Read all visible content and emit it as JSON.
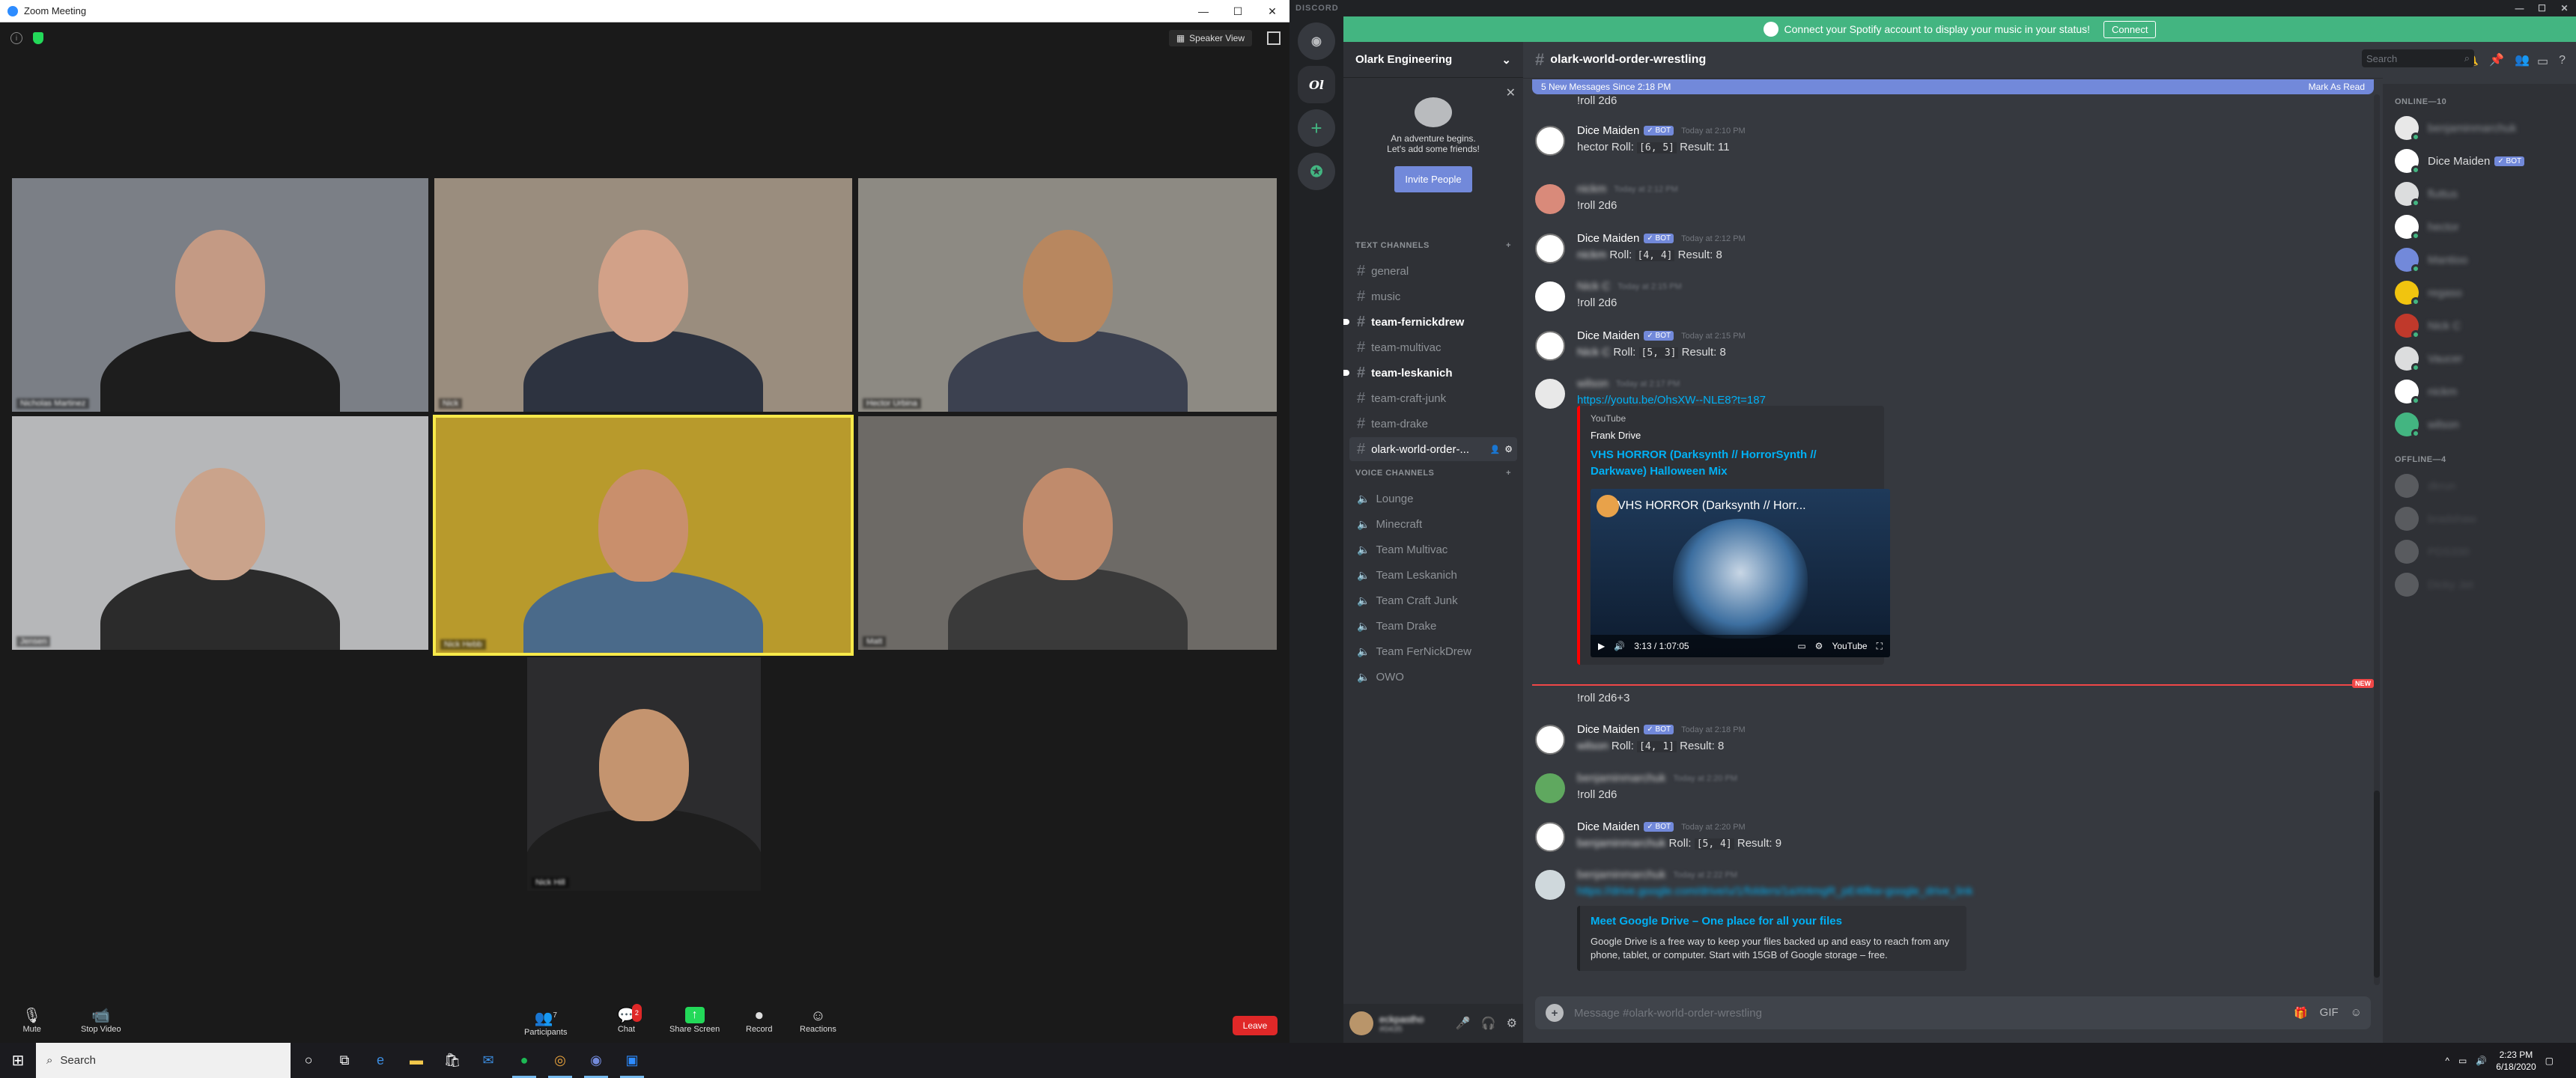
{
  "zoom": {
    "window_title": "Zoom Meeting",
    "speaker_view": "Speaker View",
    "toolbar": {
      "mute": "Mute",
      "stop_video": "Stop Video",
      "participants": "Participants",
      "participants_count": "7",
      "chat": "Chat",
      "chat_badge": "2",
      "share_screen": "Share Screen",
      "record": "Record",
      "reactions": "Reactions",
      "leave": "Leave"
    },
    "participants": [
      {
        "name": "Nicholas Martinez",
        "bg": "#7b7f86",
        "face": "#c49a84",
        "shirt": "#1d1d1d"
      },
      {
        "name": "Nick",
        "bg": "#9a8d7e",
        "face": "#d2a188",
        "shirt": "#2d3340"
      },
      {
        "name": "Hector Urbina",
        "bg": "#8d8a83",
        "face": "#b8875f",
        "shirt": "#3c4150"
      },
      {
        "name": "Jensen",
        "bg": "#b6b7b9",
        "face": "#caa38b",
        "shirt": "#2b2b2b"
      },
      {
        "name": "Nick Hebb",
        "bg": "#b89a2c",
        "face": "#c98f6c",
        "shirt": "#4a6a8a"
      },
      {
        "name": "Matt",
        "bg": "#6d6a66",
        "face": "#c08b6c",
        "shirt": "#3a3a3a"
      },
      {
        "name": "Nick Hill",
        "bg": "#2c2c2e",
        "face": "#c4946f",
        "shirt": "#1e1e1e"
      }
    ]
  },
  "discord": {
    "titlebar": "DISCORD",
    "spotify_text": "Connect your Spotify account to display your music in your status!",
    "spotify_connect": "Connect",
    "server_name": "Olark Engineering",
    "welcome_line1": "An adventure begins.",
    "welcome_line2": "Let's add some friends!",
    "invite_button": "Invite People",
    "text_channels_label": "TEXT CHANNELS",
    "voice_channels_label": "VOICE CHANNELS",
    "text_channels": [
      {
        "name": "general",
        "unread": false
      },
      {
        "name": "music",
        "unread": false
      },
      {
        "name": "team-fernickdrew",
        "unread": true
      },
      {
        "name": "team-multivac",
        "unread": false
      },
      {
        "name": "team-leskanich",
        "unread": true
      },
      {
        "name": "team-craft-junk",
        "unread": false
      },
      {
        "name": "team-drake",
        "unread": false
      },
      {
        "name": "olark-world-order-...",
        "unread": false,
        "selected": true
      }
    ],
    "voice_channels": [
      "Lounge",
      "Minecraft",
      "Team Multivac",
      "Team Leskanich",
      "Team Craft Junk",
      "Team Drake",
      "Team FerNickDrew",
      "OWO"
    ],
    "user_name": "eckpastho",
    "user_tag": "#0435",
    "channel_title": "olark-world-order-wrestling",
    "new_messages": "5 New Messages Since 2:18 PM",
    "mark_as_read": "Mark As Read",
    "top_partial": "!roll 2d6",
    "messages": [
      {
        "author": "Dice Maiden",
        "bot": true,
        "ts": "Today at 2:10 PM",
        "pre": "hector Roll: ",
        "code": "[6, 5]",
        "post": " Result: 11"
      },
      {
        "author": "nickm",
        "bot": false,
        "ts": "Today at 2:12 PM",
        "text": "!roll 2d6"
      },
      {
        "author": "Dice Maiden",
        "bot": true,
        "ts": "Today at 2:12 PM",
        "blurpre": "nickm",
        "pre": " Roll: ",
        "code": "[4, 4]",
        "post": " Result: 8"
      },
      {
        "author": "Nick C",
        "bot": false,
        "ts": "Today at 2:15 PM",
        "text": "!roll 2d6"
      },
      {
        "author": "Dice Maiden",
        "bot": true,
        "ts": "Today at 2:15 PM",
        "blurpre": "Nick C",
        "pre": " Roll: ",
        "code": "[5, 3]",
        "post": " Result: 8"
      },
      {
        "author": "wilson",
        "bot": false,
        "ts": "Today at 2:17 PM",
        "link": "https://youtu.be/OhsXW--NLE8?t=187"
      },
      {
        "author": "Dice Maiden",
        "bot": true,
        "ts": "Today at 2:18 PM",
        "blurpre": "wilson",
        "pre": " Roll: ",
        "code": "[4, 1]",
        "post": " Result: 8"
      },
      {
        "author": "benjaminmarchuk",
        "bot": false,
        "ts": "Today at 2:20 PM",
        "text": "!roll 2d6"
      },
      {
        "author": "Dice Maiden",
        "bot": true,
        "ts": "Today at 2:20 PM",
        "blurpre": "benjaminmarchuk",
        "pre": " Roll: ",
        "code": "[5, 4]",
        "post": " Result: 9"
      },
      {
        "author": "benjaminmarchuk",
        "bot": false,
        "ts": "Today at 2:22 PM",
        "link_blur": "https://drive.google.com/drive/u/1/folders/1aXt4mgR_pE4tfkw-google_drive_link"
      }
    ],
    "bot_tag": "✓ BOT",
    "continuation": "!roll 2d6+3",
    "new_label": "NEW",
    "yt_embed": {
      "provider": "YouTube",
      "author": "Frank Drive",
      "title": "VHS HORROR (Darksynth // HorrorSynth // Darkwave) Halloween Mix",
      "video_title": "VHS HORROR (Darksynth // Horr...",
      "time": "3:13 / 1:07:05",
      "yt_label": "YouTube"
    },
    "gd_embed": {
      "title": "Meet Google Drive – One place for all your files",
      "desc": "Google Drive is a free way to keep your files backed up and easy to reach from any phone, tablet, or computer. Start with 15GB of Google storage – free."
    },
    "input_placeholder": "Message #olark-world-order-wrestling",
    "search_placeholder": "Search",
    "online_label": "ONLINE—10",
    "offline_label": "OFFLINE—4",
    "online_members": [
      "benjaminmarchuk",
      "Dice Maiden",
      "fluttus",
      "hector",
      "Mantioo",
      "regaso",
      "Nick C",
      "Vaucer",
      "nickm",
      "wilson"
    ],
    "offline_members": [
      "dkrun",
      "bradshaw",
      "PDS330",
      "Dicky Jet"
    ]
  },
  "taskbar": {
    "search": "Search",
    "time": "2:23 PM",
    "date": "6/18/2020"
  }
}
